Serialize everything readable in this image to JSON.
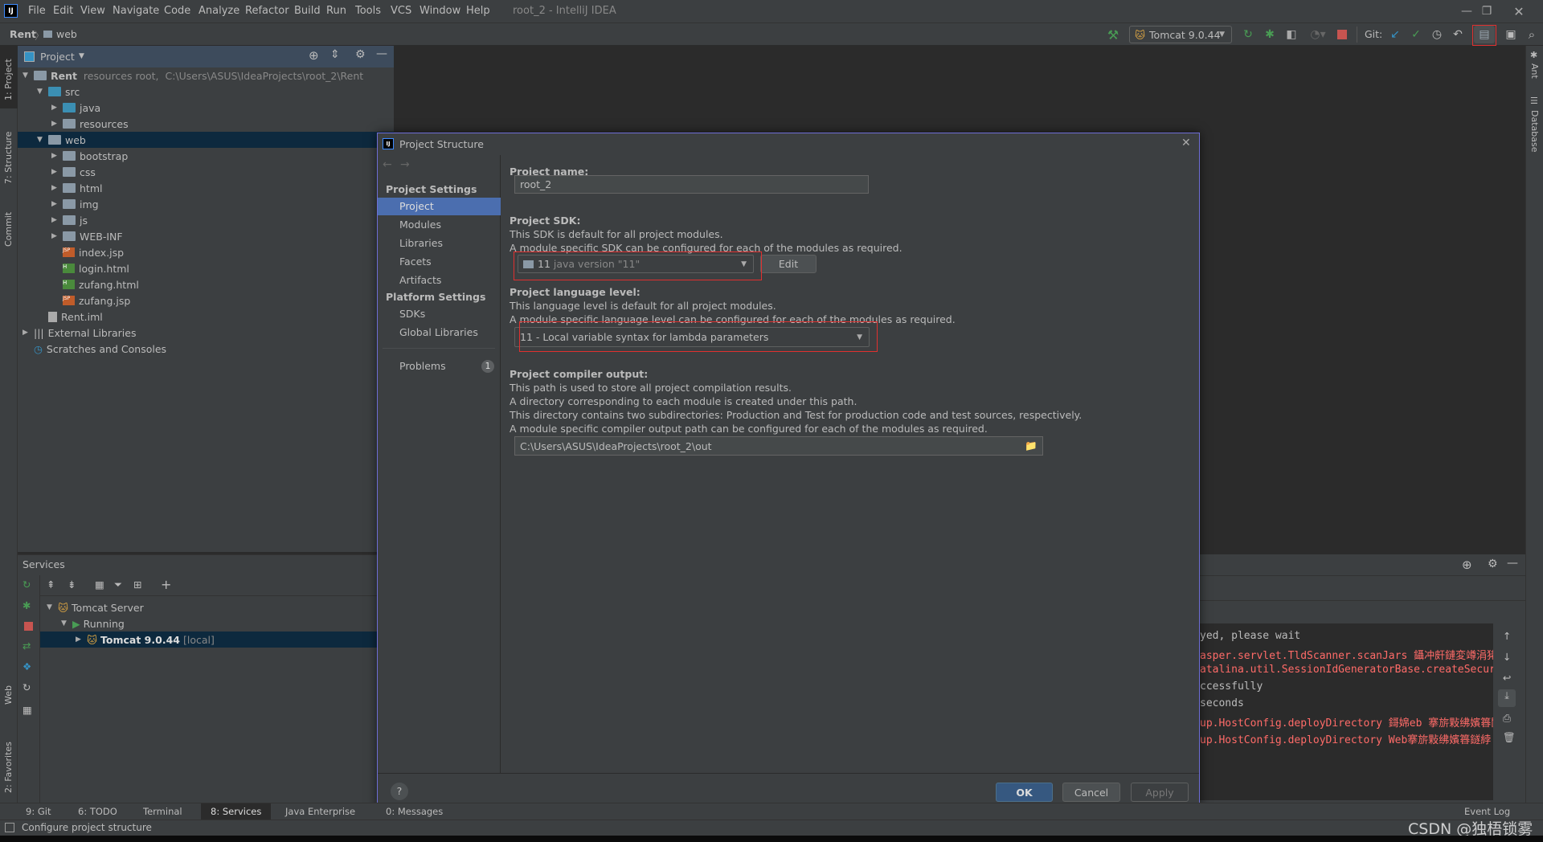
{
  "window": {
    "title": "root_2 - IntelliJ IDEA",
    "menu": [
      "File",
      "Edit",
      "View",
      "Navigate",
      "Code",
      "Analyze",
      "Refactor",
      "Build",
      "Run",
      "Tools",
      "VCS",
      "Window",
      "Help"
    ]
  },
  "breadcrumb": [
    "Rent",
    "web"
  ],
  "toolbar": {
    "run_config": "Tomcat 9.0.44",
    "git_label": "Git:"
  },
  "left_stripe": [
    "1: Project",
    "7: Structure",
    "Commit",
    "Web",
    "2: Favorites"
  ],
  "right_stripe": [
    "Ant",
    "Database"
  ],
  "project_panel": {
    "title": "Project",
    "tree": [
      {
        "name": "Rent",
        "hint": "resources root,  C:\\Users\\ASUS\\IdeaProjects\\root_2\\Rent",
        "level": 0,
        "expanded": true,
        "type": "module"
      },
      {
        "name": "src",
        "level": 1,
        "expanded": true,
        "type": "folder"
      },
      {
        "name": "java",
        "level": 2,
        "expanded": false,
        "type": "folder"
      },
      {
        "name": "resources",
        "level": 2,
        "expanded": false,
        "type": "folder"
      },
      {
        "name": "web",
        "level": 1,
        "expanded": true,
        "type": "web",
        "selected": true
      },
      {
        "name": "bootstrap",
        "level": 2,
        "expanded": false,
        "type": "folder"
      },
      {
        "name": "css",
        "level": 2,
        "expanded": false,
        "type": "folder"
      },
      {
        "name": "html",
        "level": 2,
        "expanded": false,
        "type": "folder"
      },
      {
        "name": "img",
        "level": 2,
        "expanded": false,
        "type": "folder"
      },
      {
        "name": "js",
        "level": 2,
        "expanded": false,
        "type": "folder"
      },
      {
        "name": "WEB-INF",
        "level": 2,
        "expanded": false,
        "type": "folder"
      },
      {
        "name": "index.jsp",
        "level": 2,
        "type": "jsp"
      },
      {
        "name": "login.html",
        "level": 2,
        "type": "html"
      },
      {
        "name": "zufang.html",
        "level": 2,
        "type": "html"
      },
      {
        "name": "zufang.jsp",
        "level": 2,
        "type": "jsp"
      },
      {
        "name": "Rent.iml",
        "level": 1,
        "type": "iml"
      },
      {
        "name": "External Libraries",
        "level": 0,
        "expanded": false,
        "type": "libs"
      },
      {
        "name": "Scratches and Consoles",
        "level": 0,
        "type": "scratch"
      }
    ]
  },
  "services": {
    "title": "Services",
    "tree": [
      {
        "name": "Tomcat Server",
        "level": 0
      },
      {
        "name": "Running",
        "level": 1
      },
      {
        "name": "Tomcat 9.0.44",
        "suffix": "[local]",
        "level": 2,
        "selected": true
      }
    ]
  },
  "console": {
    "lines": [
      {
        "text": "yed, please wait",
        "color": "#bbbbbb"
      },
      {
        "text": "asper.servlet.TldScanner.scanJars 鑷冲皯鏈変竴涓狫",
        "color": "#ff6b68"
      },
      {
        "text": "atalina.util.SessionIdGeneratorBase.createSecure",
        "color": "#ff6b68"
      },
      {
        "text": "ccessfully",
        "color": "#bbbbbb"
      },
      {
        "text": "seconds",
        "color": "#bbbbbb"
      },
      {
        "text": "up.HostConfig.deployDirectory 鎶婂eb 搴旂敤绋嬪簭閮",
        "color": "#ff6b68"
      },
      {
        "text": "up.HostConfig.deployDirectory Web搴旂敤绋嬪簭鐩綍",
        "color": "#ff6b68"
      }
    ]
  },
  "dialog": {
    "title": "Project Structure",
    "nav": {
      "project_settings": "Project Settings",
      "items1": [
        "Project",
        "Modules",
        "Libraries",
        "Facets",
        "Artifacts"
      ],
      "platform_settings": "Platform Settings",
      "items2": [
        "SDKs",
        "Global Libraries"
      ],
      "problems": "Problems",
      "problems_count": "1",
      "selected": "Project"
    },
    "name_label": "Project name:",
    "name_value": "root_2",
    "sdk_label": "Project SDK:",
    "sdk_desc1": "This SDK is default for all project modules.",
    "sdk_desc2": "A module specific SDK can be configured for each of the modules as required.",
    "sdk_value_version": "11",
    "sdk_value_detail": "java version \"11\"",
    "edit_button": "Edit",
    "lang_label": "Project language level:",
    "lang_desc1": "This language level is default for all project modules.",
    "lang_desc2": "A module specific language level can be configured for each of the modules as required.",
    "lang_value": "11 - Local variable syntax for lambda parameters",
    "out_label": "Project compiler output:",
    "out_desc": [
      "This path is used to store all project compilation results.",
      "A directory corresponding to each module is created under this path.",
      "This directory contains two subdirectories: Production and Test for production code and test sources, respectively.",
      "A module specific compiler output path can be configured for each of the modules as required."
    ],
    "out_value": "C:\\Users\\ASUS\\IdeaProjects\\root_2\\out",
    "ok": "OK",
    "cancel": "Cancel",
    "apply": "Apply",
    "help": "?"
  },
  "bottom_tabs": [
    "9: Git",
    "6: TODO",
    "Terminal",
    "8: Services",
    "Java Enterprise",
    "0: Messages"
  ],
  "event_log": "Event Log",
  "status": "Configure project structure",
  "watermark": "CSDN @独梧锁雾",
  "colors": {
    "accent": "#4b6eaf",
    "highlight": "#e0302f",
    "selection": "#0d293e",
    "error": "#ff6b68"
  }
}
